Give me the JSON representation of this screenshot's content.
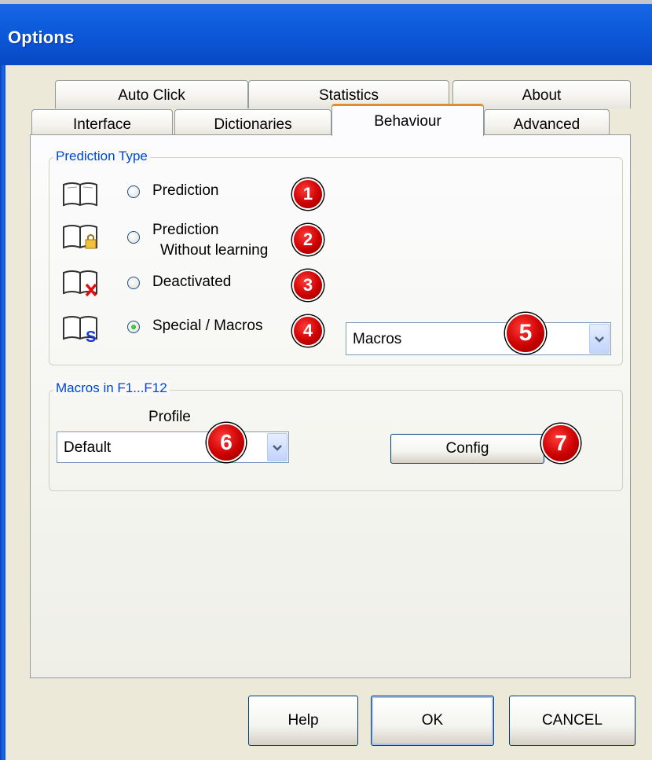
{
  "window": {
    "title": "Options"
  },
  "tabs_back": [
    {
      "label": "Auto Click"
    },
    {
      "label": "Statistics"
    },
    {
      "label": "About"
    }
  ],
  "tabs_front": [
    {
      "label": "Interface"
    },
    {
      "label": "Dictionaries"
    },
    {
      "label": "Behaviour",
      "active": true
    },
    {
      "label": "Advanced"
    }
  ],
  "prediction_group": {
    "title": "Prediction Type",
    "options": [
      {
        "label": "Prediction",
        "checked": false,
        "badge": "1",
        "icon": "book-icon"
      },
      {
        "label_line1": "Prediction",
        "label_line2": "Without learning",
        "checked": false,
        "badge": "2",
        "icon": "book-lock-icon"
      },
      {
        "label": "Deactivated",
        "checked": false,
        "badge": "3",
        "icon": "book-x-icon"
      },
      {
        "label": "Special / Macros",
        "checked": true,
        "badge": "4",
        "icon": "book-s-icon"
      }
    ],
    "combo": {
      "value": "Macros",
      "badge": "5"
    }
  },
  "macros_group": {
    "title": "Macros in F1...F12",
    "profile_label": "Profile",
    "profile_combo": {
      "value": "Default",
      "badge": "6"
    },
    "config_button": {
      "label": "Config",
      "badge": "7"
    }
  },
  "footer": {
    "help_label": "Help",
    "ok_label": "OK",
    "cancel_label": "CANCEL"
  },
  "colors": {
    "titlebar": "#0a55d6",
    "active_tab_accent": "#e68b2c",
    "group_title": "#0046d5",
    "badge": "#cc0000"
  }
}
